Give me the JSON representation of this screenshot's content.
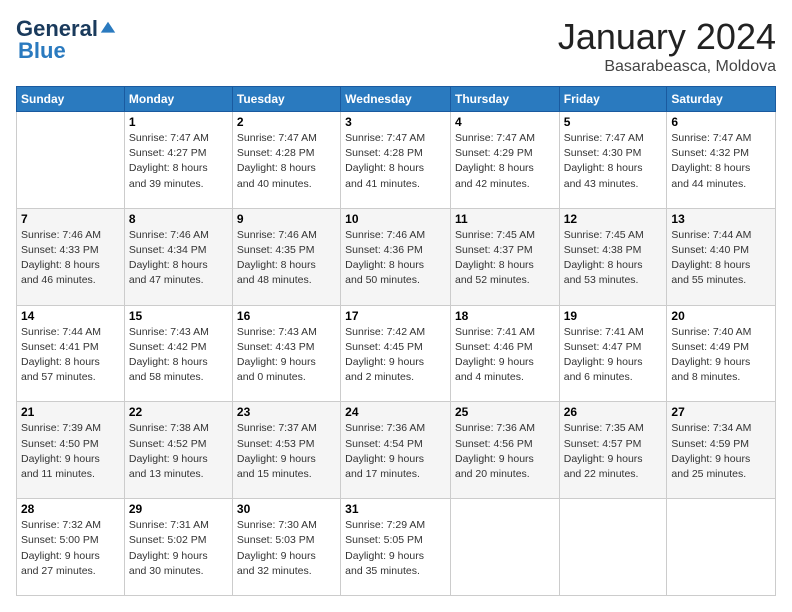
{
  "header": {
    "logo_general": "General",
    "logo_blue": "Blue",
    "month_title": "January 2024",
    "location": "Basarabeasca, Moldova"
  },
  "days_of_week": [
    "Sunday",
    "Monday",
    "Tuesday",
    "Wednesday",
    "Thursday",
    "Friday",
    "Saturday"
  ],
  "weeks": [
    [
      {
        "num": "",
        "detail": ""
      },
      {
        "num": "1",
        "detail": "Sunrise: 7:47 AM\nSunset: 4:27 PM\nDaylight: 8 hours\nand 39 minutes."
      },
      {
        "num": "2",
        "detail": "Sunrise: 7:47 AM\nSunset: 4:28 PM\nDaylight: 8 hours\nand 40 minutes."
      },
      {
        "num": "3",
        "detail": "Sunrise: 7:47 AM\nSunset: 4:28 PM\nDaylight: 8 hours\nand 41 minutes."
      },
      {
        "num": "4",
        "detail": "Sunrise: 7:47 AM\nSunset: 4:29 PM\nDaylight: 8 hours\nand 42 minutes."
      },
      {
        "num": "5",
        "detail": "Sunrise: 7:47 AM\nSunset: 4:30 PM\nDaylight: 8 hours\nand 43 minutes."
      },
      {
        "num": "6",
        "detail": "Sunrise: 7:47 AM\nSunset: 4:32 PM\nDaylight: 8 hours\nand 44 minutes."
      }
    ],
    [
      {
        "num": "7",
        "detail": "Sunrise: 7:46 AM\nSunset: 4:33 PM\nDaylight: 8 hours\nand 46 minutes."
      },
      {
        "num": "8",
        "detail": "Sunrise: 7:46 AM\nSunset: 4:34 PM\nDaylight: 8 hours\nand 47 minutes."
      },
      {
        "num": "9",
        "detail": "Sunrise: 7:46 AM\nSunset: 4:35 PM\nDaylight: 8 hours\nand 48 minutes."
      },
      {
        "num": "10",
        "detail": "Sunrise: 7:46 AM\nSunset: 4:36 PM\nDaylight: 8 hours\nand 50 minutes."
      },
      {
        "num": "11",
        "detail": "Sunrise: 7:45 AM\nSunset: 4:37 PM\nDaylight: 8 hours\nand 52 minutes."
      },
      {
        "num": "12",
        "detail": "Sunrise: 7:45 AM\nSunset: 4:38 PM\nDaylight: 8 hours\nand 53 minutes."
      },
      {
        "num": "13",
        "detail": "Sunrise: 7:44 AM\nSunset: 4:40 PM\nDaylight: 8 hours\nand 55 minutes."
      }
    ],
    [
      {
        "num": "14",
        "detail": "Sunrise: 7:44 AM\nSunset: 4:41 PM\nDaylight: 8 hours\nand 57 minutes."
      },
      {
        "num": "15",
        "detail": "Sunrise: 7:43 AM\nSunset: 4:42 PM\nDaylight: 8 hours\nand 58 minutes."
      },
      {
        "num": "16",
        "detail": "Sunrise: 7:43 AM\nSunset: 4:43 PM\nDaylight: 9 hours\nand 0 minutes."
      },
      {
        "num": "17",
        "detail": "Sunrise: 7:42 AM\nSunset: 4:45 PM\nDaylight: 9 hours\nand 2 minutes."
      },
      {
        "num": "18",
        "detail": "Sunrise: 7:41 AM\nSunset: 4:46 PM\nDaylight: 9 hours\nand 4 minutes."
      },
      {
        "num": "19",
        "detail": "Sunrise: 7:41 AM\nSunset: 4:47 PM\nDaylight: 9 hours\nand 6 minutes."
      },
      {
        "num": "20",
        "detail": "Sunrise: 7:40 AM\nSunset: 4:49 PM\nDaylight: 9 hours\nand 8 minutes."
      }
    ],
    [
      {
        "num": "21",
        "detail": "Sunrise: 7:39 AM\nSunset: 4:50 PM\nDaylight: 9 hours\nand 11 minutes."
      },
      {
        "num": "22",
        "detail": "Sunrise: 7:38 AM\nSunset: 4:52 PM\nDaylight: 9 hours\nand 13 minutes."
      },
      {
        "num": "23",
        "detail": "Sunrise: 7:37 AM\nSunset: 4:53 PM\nDaylight: 9 hours\nand 15 minutes."
      },
      {
        "num": "24",
        "detail": "Sunrise: 7:36 AM\nSunset: 4:54 PM\nDaylight: 9 hours\nand 17 minutes."
      },
      {
        "num": "25",
        "detail": "Sunrise: 7:36 AM\nSunset: 4:56 PM\nDaylight: 9 hours\nand 20 minutes."
      },
      {
        "num": "26",
        "detail": "Sunrise: 7:35 AM\nSunset: 4:57 PM\nDaylight: 9 hours\nand 22 minutes."
      },
      {
        "num": "27",
        "detail": "Sunrise: 7:34 AM\nSunset: 4:59 PM\nDaylight: 9 hours\nand 25 minutes."
      }
    ],
    [
      {
        "num": "28",
        "detail": "Sunrise: 7:32 AM\nSunset: 5:00 PM\nDaylight: 9 hours\nand 27 minutes."
      },
      {
        "num": "29",
        "detail": "Sunrise: 7:31 AM\nSunset: 5:02 PM\nDaylight: 9 hours\nand 30 minutes."
      },
      {
        "num": "30",
        "detail": "Sunrise: 7:30 AM\nSunset: 5:03 PM\nDaylight: 9 hours\nand 32 minutes."
      },
      {
        "num": "31",
        "detail": "Sunrise: 7:29 AM\nSunset: 5:05 PM\nDaylight: 9 hours\nand 35 minutes."
      },
      {
        "num": "",
        "detail": ""
      },
      {
        "num": "",
        "detail": ""
      },
      {
        "num": "",
        "detail": ""
      }
    ]
  ]
}
